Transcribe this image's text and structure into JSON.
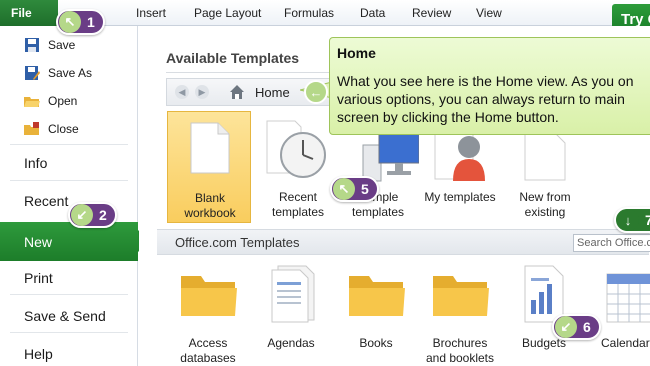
{
  "ribbon": {
    "file_label": "File",
    "tabs": [
      "Insert",
      "Page Layout",
      "Formulas",
      "Data",
      "Review",
      "View"
    ],
    "try_label": "Try C"
  },
  "leftnav": {
    "commands": [
      "Save",
      "Save As",
      "Open",
      "Close"
    ],
    "sections": {
      "info": "Info",
      "recent": "Recent",
      "new": "New",
      "print": "Print",
      "save_send": "Save & Send",
      "help": "Help"
    }
  },
  "main": {
    "available_title": "Available Templates",
    "nav_home": "Home",
    "templates": [
      {
        "label_line1": "Blank",
        "label_line2": "workbook"
      },
      {
        "label_line1": "Recent",
        "label_line2": "templates"
      },
      {
        "label_line1": "Sample",
        "label_line2": "templates"
      },
      {
        "label_line1": "My templates",
        "label_line2": ""
      },
      {
        "label_line1": "New from",
        "label_line2": "existing"
      }
    ],
    "office_title": "Office.com Templates",
    "search_placeholder": "Search Office.com",
    "categories": [
      {
        "line1": "Access",
        "line2": "databases"
      },
      {
        "line1": "Agendas",
        "line2": ""
      },
      {
        "line1": "Books",
        "line2": ""
      },
      {
        "line1": "Brochures",
        "line2": "and booklets"
      },
      {
        "line1": "Budgets",
        "line2": ""
      },
      {
        "line1": "Calendars",
        "line2": ""
      }
    ]
  },
  "callout": {
    "title": "Home",
    "body": "What you see here is the Home view. As you on various options, you can always return to main screen by clicking the Home button."
  },
  "badges": [
    "1",
    "2",
    "5",
    "6",
    "7"
  ],
  "colors": {
    "file_green": "#2f8a3c",
    "badge_purple": "#6a3d86",
    "badge_circle": "#b5d889",
    "callout_bg": "#e4f5c2",
    "blank_tile": "#fbd673",
    "folder": "#f7c64a"
  }
}
